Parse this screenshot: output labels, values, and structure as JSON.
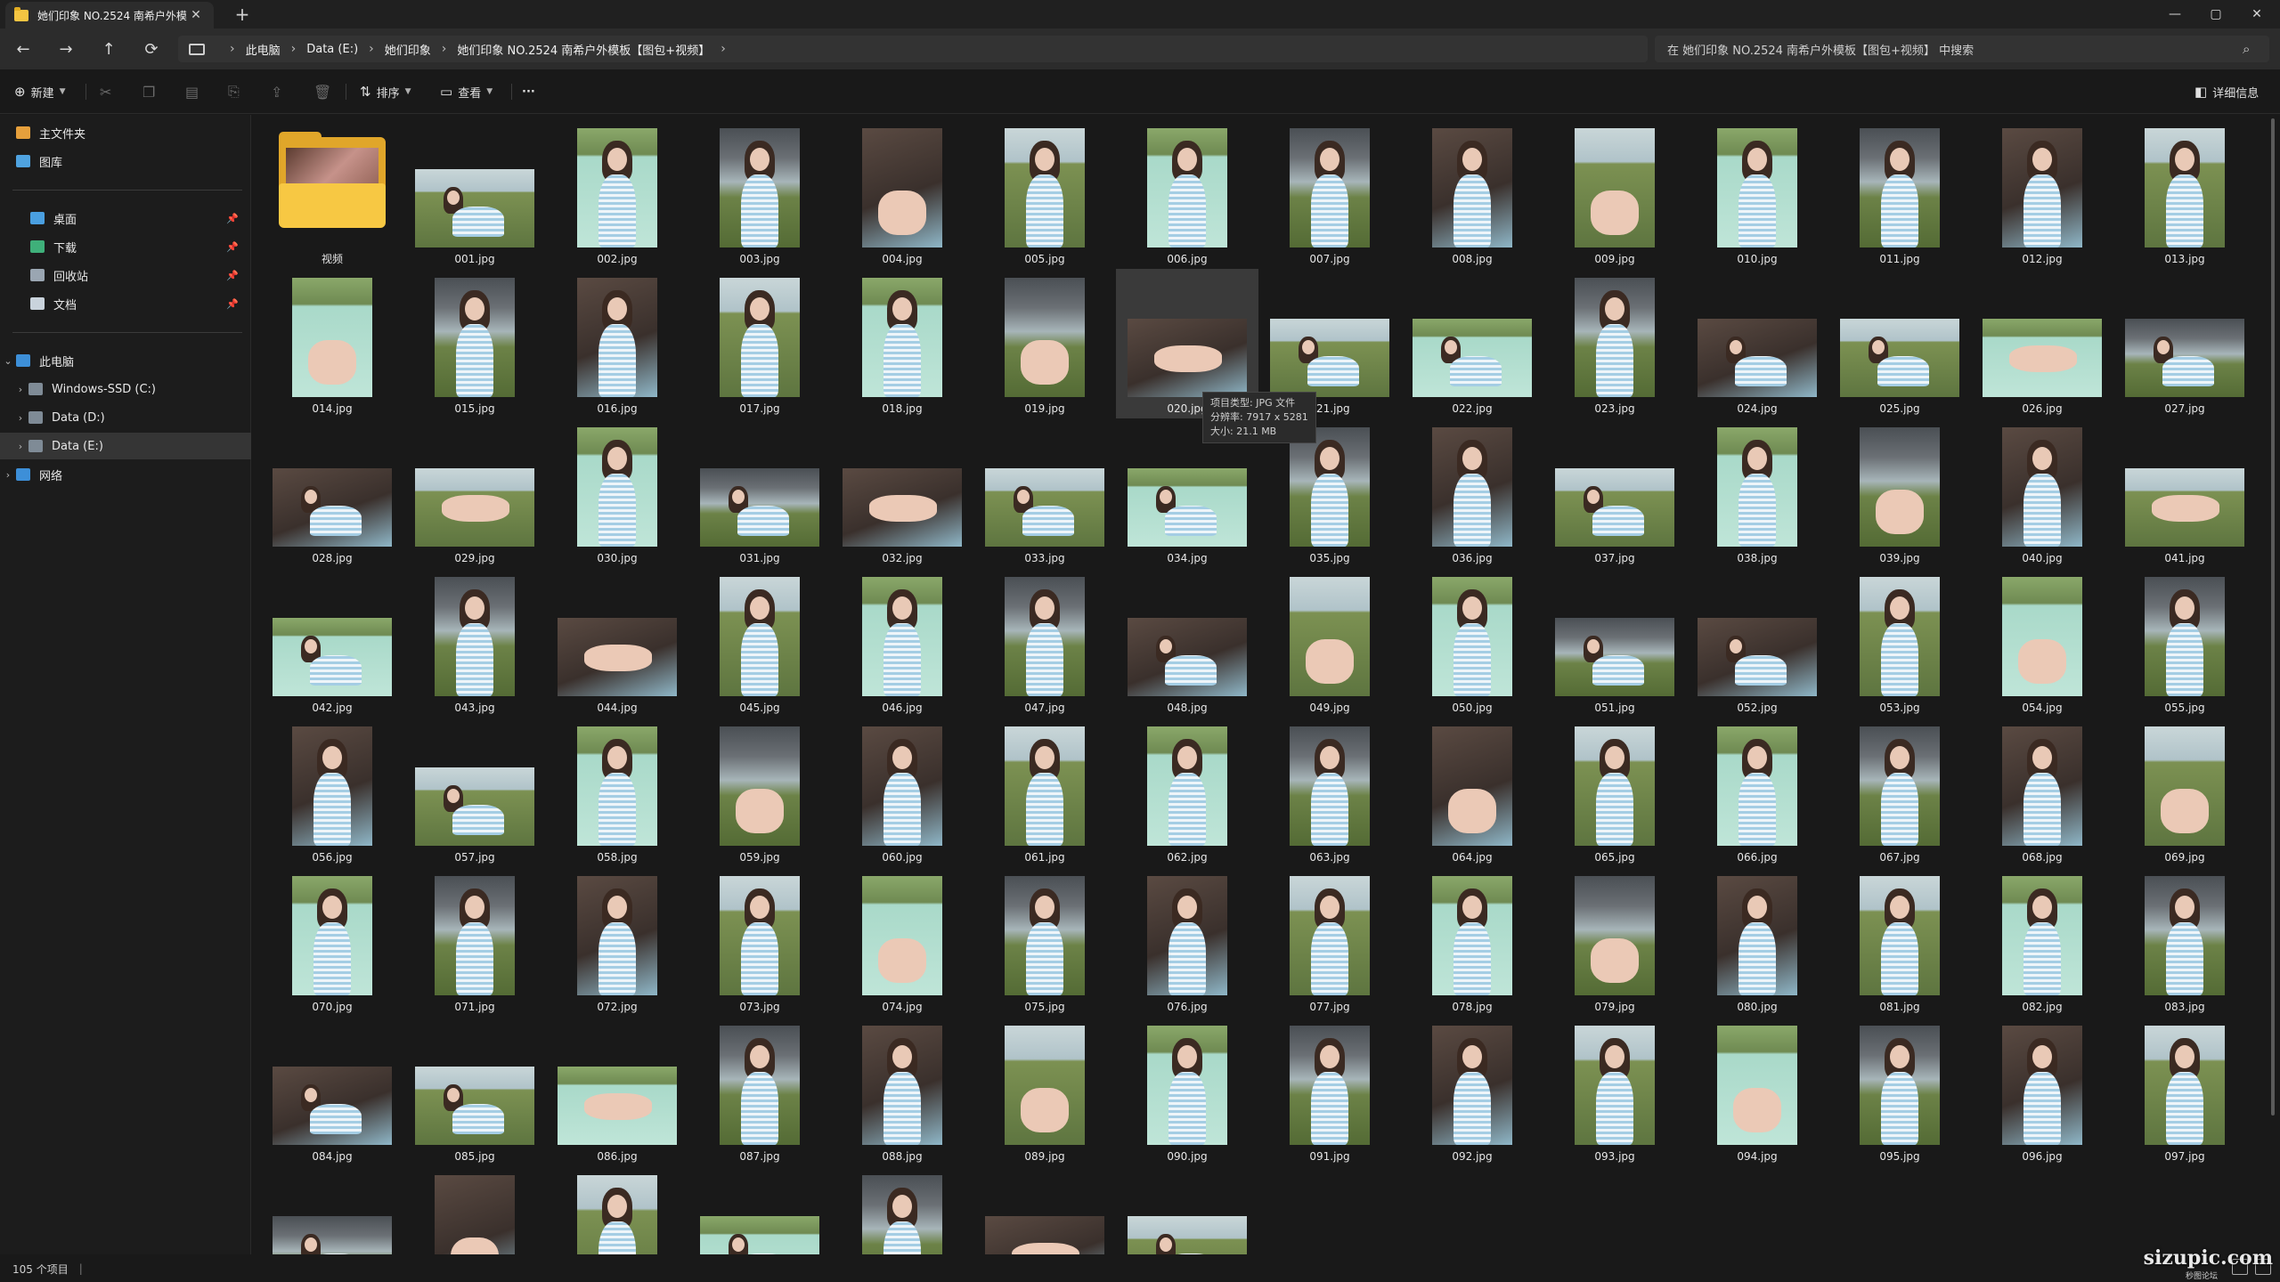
{
  "tab": {
    "title": "她们印象 NO.2524 南希户外模板",
    "close": "✕",
    "new": "+"
  },
  "window": {
    "minimize": "—",
    "maximize": "▢",
    "close": "✕"
  },
  "nav": {
    "back": "←",
    "forward": "→",
    "up": "↑",
    "refresh": "⟳"
  },
  "breadcrumb": [
    "此电脑",
    "Data (E:)",
    "她们印象",
    "她们印象 NO.2524 南希户外模板【图包+视频】"
  ],
  "search": {
    "placeholder": "在 她们印象 NO.2524 南希户外模板【图包+视频】 中搜索"
  },
  "commands": {
    "new": "新建",
    "sort": "排序",
    "view": "查看",
    "more": "···",
    "details": "详细信息"
  },
  "sidebar": {
    "pinned": [
      {
        "label": "主文件夹",
        "icon": "home-icon"
      },
      {
        "label": "图库",
        "icon": "gallery-icon"
      }
    ],
    "quick": [
      {
        "label": "桌面",
        "icon": "desktop-icon",
        "pinned": true
      },
      {
        "label": "下载",
        "icon": "download-icon",
        "pinned": true
      },
      {
        "label": "回收站",
        "icon": "recycle-bin-icon",
        "pinned": true
      },
      {
        "label": "文档",
        "icon": "documents-icon",
        "pinned": true
      }
    ],
    "thispc": {
      "label": "此电脑"
    },
    "drives": [
      {
        "label": "Windows-SSD (C:)"
      },
      {
        "label": "Data (D:)"
      },
      {
        "label": "Data (E:)",
        "selected": true
      }
    ],
    "network": {
      "label": "网络"
    }
  },
  "folder_item": {
    "label": "视频"
  },
  "files": [
    "001.jpg",
    "002.jpg",
    "003.jpg",
    "004.jpg",
    "005.jpg",
    "006.jpg",
    "007.jpg",
    "008.jpg",
    "009.jpg",
    "010.jpg",
    "011.jpg",
    "012.jpg",
    "013.jpg",
    "014.jpg",
    "015.jpg",
    "016.jpg",
    "017.jpg",
    "018.jpg",
    "019.jpg",
    "020.jpg",
    "021.jpg",
    "022.jpg",
    "023.jpg",
    "024.jpg",
    "025.jpg",
    "026.jpg",
    "027.jpg",
    "028.jpg",
    "029.jpg",
    "030.jpg",
    "031.jpg",
    "032.jpg",
    "033.jpg",
    "034.jpg",
    "035.jpg",
    "036.jpg",
    "037.jpg",
    "038.jpg",
    "039.jpg",
    "040.jpg",
    "041.jpg",
    "042.jpg",
    "043.jpg",
    "044.jpg",
    "045.jpg",
    "046.jpg",
    "047.jpg",
    "048.jpg",
    "049.jpg",
    "050.jpg",
    "051.jpg",
    "052.jpg",
    "053.jpg",
    "054.jpg",
    "055.jpg",
    "056.jpg",
    "057.jpg",
    "058.jpg",
    "059.jpg",
    "060.jpg",
    "061.jpg",
    "062.jpg",
    "063.jpg",
    "064.jpg",
    "065.jpg",
    "066.jpg",
    "067.jpg",
    "068.jpg",
    "069.jpg",
    "070.jpg",
    "071.jpg",
    "072.jpg",
    "073.jpg",
    "074.jpg",
    "075.jpg",
    "076.jpg",
    "077.jpg",
    "078.jpg",
    "079.jpg",
    "080.jpg",
    "081.jpg",
    "082.jpg",
    "083.jpg",
    "084.jpg",
    "085.jpg",
    "086.jpg",
    "087.jpg",
    "088.jpg",
    "089.jpg",
    "090.jpg",
    "091.jpg",
    "092.jpg",
    "093.jpg",
    "094.jpg",
    "095.jpg",
    "096.jpg",
    "097.jpg"
  ],
  "landscape": [
    "001.jpg",
    "020.jpg",
    "021.jpg",
    "022.jpg",
    "024.jpg",
    "025.jpg",
    "026.jpg",
    "027.jpg",
    "028.jpg",
    "029.jpg",
    "031.jpg",
    "032.jpg",
    "033.jpg",
    "034.jpg",
    "037.jpg",
    "041.jpg",
    "042.jpg",
    "044.jpg",
    "048.jpg",
    "051.jpg",
    "052.jpg",
    "057.jpg",
    "084.jpg",
    "085.jpg",
    "086.jpg"
  ],
  "partial_row_kinds": [
    "l",
    "p",
    "p",
    "l",
    "p",
    "l",
    "l"
  ],
  "hovered": "020.jpg",
  "tooltip": {
    "type": "项目类型: JPG 文件",
    "dims": "分辨率: 7917 x 5281",
    "size": "大小: 21.1 MB"
  },
  "status": {
    "count": "105 个项目",
    "sep": "|"
  },
  "watermark": {
    "main": "sizupic.com",
    "sub": "秒图论坛"
  },
  "colors": {
    "accent": "#60cdff",
    "folder": "#f7c843",
    "background": "#191919"
  }
}
